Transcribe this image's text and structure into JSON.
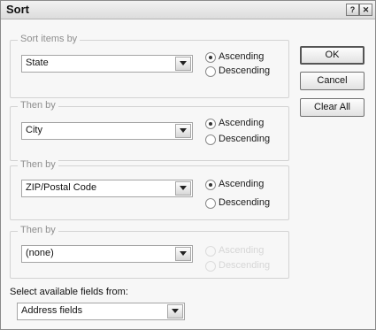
{
  "window": {
    "title": "Sort",
    "help_label": "?",
    "close_label": "✕"
  },
  "sort_groups": [
    {
      "legend": "Sort items by",
      "selected": "State",
      "ascending": "Ascending",
      "descending": "Descending",
      "order": "ascending",
      "enabled": true
    },
    {
      "legend": "Then by",
      "selected": "City",
      "ascending": "Ascending",
      "descending": "Descending",
      "order": "ascending",
      "enabled": true
    },
    {
      "legend": "Then by",
      "selected": "ZIP/Postal Code",
      "ascending": "Ascending",
      "descending": "Descending",
      "order": "ascending",
      "enabled": true
    },
    {
      "legend": "Then by",
      "selected": "(none)",
      "ascending": "Ascending",
      "descending": "Descending",
      "order": "none",
      "enabled": false
    }
  ],
  "buttons": {
    "ok": "OK",
    "cancel": "Cancel",
    "clear_all": "Clear All"
  },
  "fields_source": {
    "label": "Select available fields from:",
    "selected": "Address fields"
  },
  "icons": {
    "dropdown": "chevron-down-icon",
    "help": "help-icon",
    "close": "close-icon"
  }
}
